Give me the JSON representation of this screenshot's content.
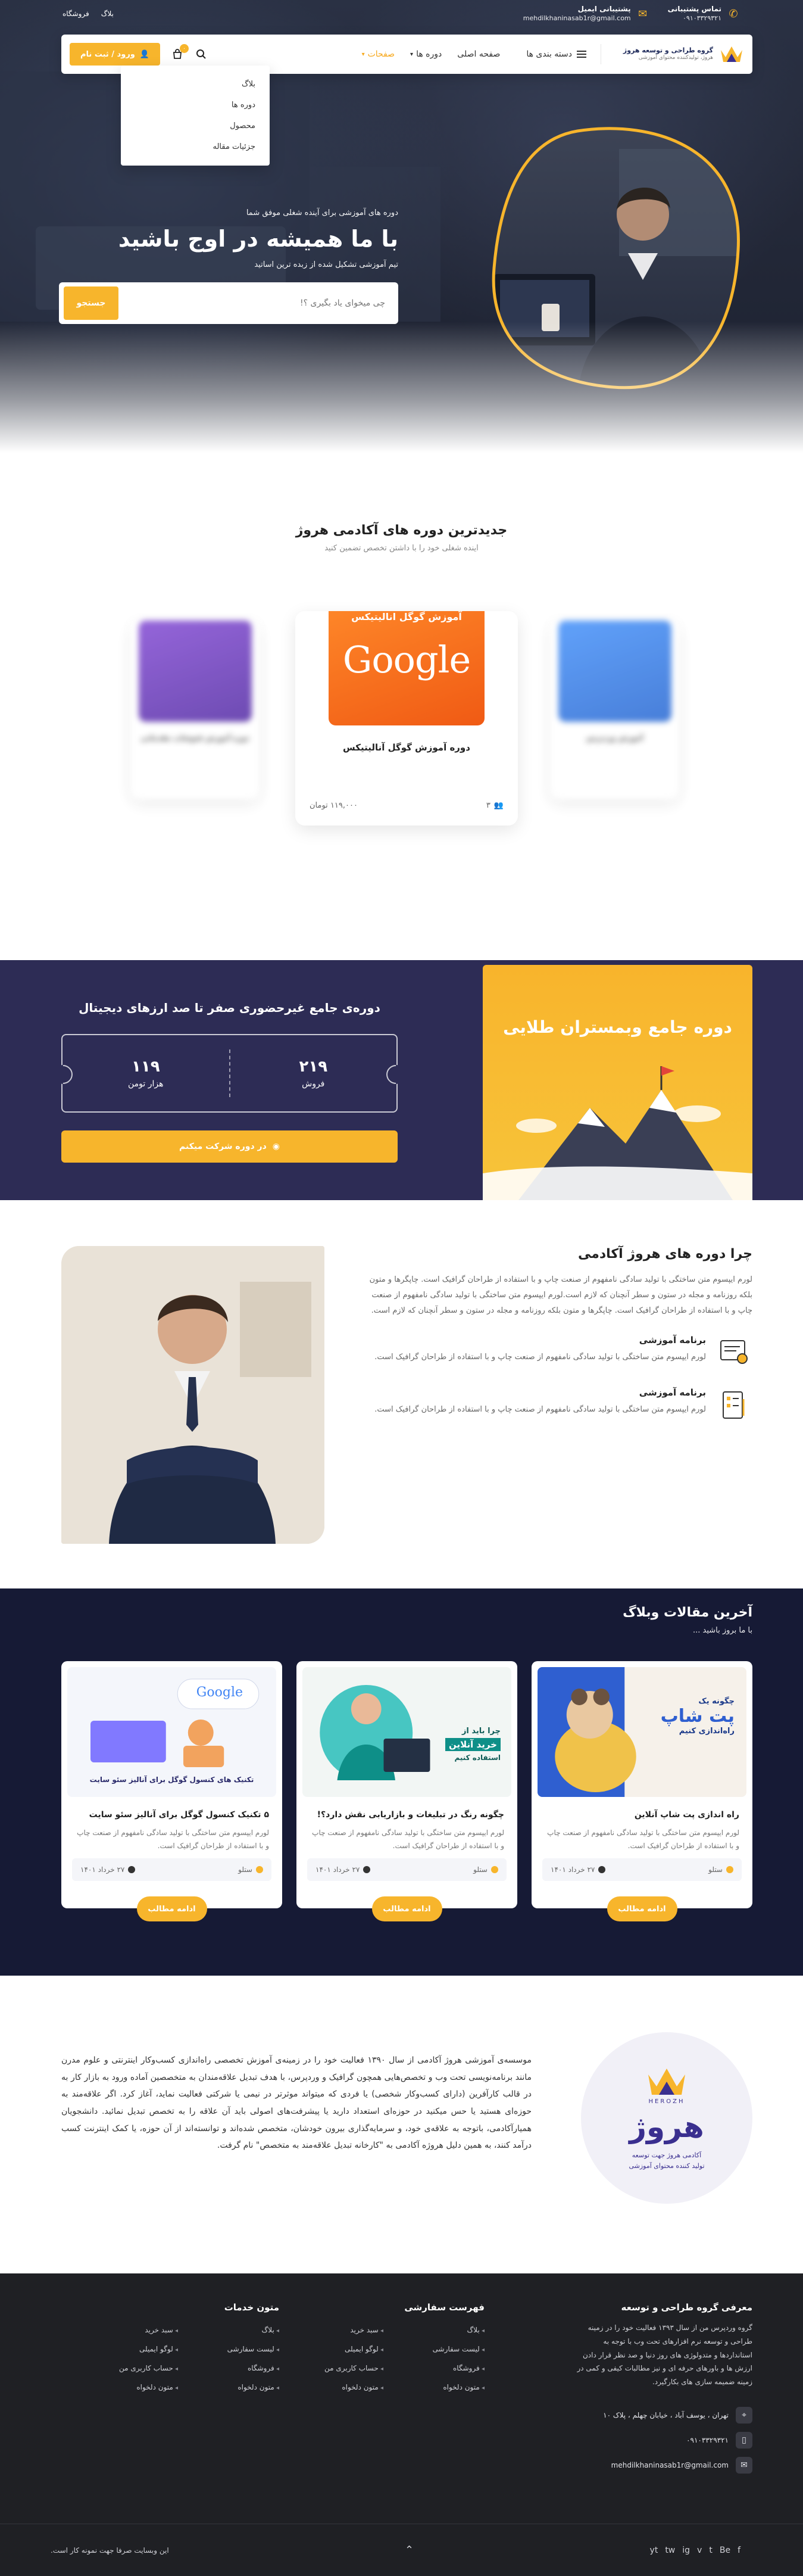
{
  "topbar": {
    "phone_label": "تماس پشتیبانی",
    "phone": "۰۹۱۰۳۳۲۹۳۲۱",
    "email_label": "پشتیبانی ایمیل",
    "email": "mehdilkhaninasab1r@gmail.com",
    "links": [
      "بلاگ",
      "فروشگاه"
    ]
  },
  "header": {
    "logo_title": "گروه طراحی و توسعه هروژ",
    "logo_subtitle": "هروژ، تولیدکننده محتوای آموزشی",
    "categories_label": "دسته بندی ها",
    "menu": [
      {
        "label": "صفحه اصلی",
        "caret": false,
        "active": false
      },
      {
        "label": "دوره ها",
        "caret": true,
        "active": false
      },
      {
        "label": "صفحات",
        "caret": true,
        "active": true
      }
    ],
    "cart_count": "۰",
    "login_label": "ورود / ثبت نام"
  },
  "dropdown": {
    "items": [
      "بلاگ",
      "دوره ها",
      "محصول",
      "جزئیات مقاله"
    ]
  },
  "hero": {
    "kicker": "دوره های آموزشی برای آینده شغلی موفق شما",
    "title": "با ما همیشه در اوج باشید",
    "desc": "تیم آموزشی تشکیل شده از زبده ترین اساتید",
    "search_placeholder": "چی میخوای یاد بگیری ؟!",
    "search_button": "جستجو"
  },
  "courses": {
    "title": "جدیدترین دوره های آکادمی هروژ",
    "subtitle": "اینده شغلی خود را با داشتن تخصص تضمین کنید",
    "center": {
      "thumb_title": "آموزش گوگل انالیتیکس",
      "thumb_word": "Google",
      "title": "دوره آموزش گوگل آنالیتیکس",
      "price": "۱۱۹,۰۰۰ تومان",
      "students": "۳"
    },
    "left_title": "دوره آموزش فتوشاپ مقدماتی",
    "right_title": "آموزش وردپرس"
  },
  "promo": {
    "title": "دوره‌ی جامع غیرحضوری صفر تا صد ارزهای دیجیتال",
    "image_title": "دوره جامع وبمستران طلایی",
    "sales_value": "۲۱۹",
    "sales_label": "فروش",
    "price_value": "۱۱۹",
    "price_label": "هزار تومن",
    "button": "در دوره شرکت میکنم"
  },
  "why": {
    "title": "چرا دوره های هروژ آکادمی",
    "lead": "لورم ایپسوم متن ساختگی با تولید سادگی نامفهوم از صنعت چاپ و با استفاده از طراحان گرافیک است. چاپگرها و متون بلکه روزنامه و مجله در ستون و سطر آنچنان که لازم است.لورم ایپسوم متن ساختگی با تولید سادگی نامفهوم از صنعت چاپ و با استفاده از طراحان گرافیک است. چاپگرها و متون بلکه روزنامه و مجله در ستون و سطر آنچنان که لازم است.",
    "features": [
      {
        "title": "برنامه آموزشی",
        "text": "لورم ایپسوم متن ساختگی با تولید سادگی نامفهوم از صنعت چاپ و با استفاده از طراحان گرافیک است."
      },
      {
        "title": "برنامه آموزشی",
        "text": "لورم ایپسوم متن ساختگی با تولید سادگی نامفهوم از صنعت چاپ و با استفاده از طراحان گرافیک است."
      }
    ]
  },
  "blog": {
    "title": "آخرین مقالات وبلاگ",
    "subtitle": "با ما بروز باشید ...",
    "posts": [
      {
        "img_line1": "چگونه یک",
        "img_line2": "پت شاپ",
        "img_line3": "راه‌اندازی کنیم",
        "title": "راه اندازی پت شاپ آنلاین",
        "excerpt": "لورم ایپسوم متن ساختگی با تولید سادگی نامفهوم از صنعت چاپ و با استفاده از طراحان گرافیک است.",
        "author": "ستلو",
        "date": "۲۷ خرداد ۱۴۰۱",
        "more": "ادامه مطالب"
      },
      {
        "img_line1": "چرا باید از",
        "img_line2": "خرید آنلاین",
        "img_line3": "استفاده کنیم",
        "title": "چگونه رنگ در تبلیغات و بازاریابی نقش دارد؟!",
        "excerpt": "لورم ایپسوم متن ساختگی با تولید سادگی نامفهوم از صنعت چاپ و با استفاده از طراحان گرافیک است.",
        "author": "ستلو",
        "date": "۲۷ خرداد ۱۴۰۱",
        "more": "ادامه مطالب"
      },
      {
        "img_line1": "Google",
        "img_line2": "تکنیک های کنسول گوگل برای آنالیز سئو سایت",
        "img_line3": "",
        "title": "۵ تکنیک کنسول گوگل برای آنالیز سئو سایت",
        "excerpt": "لورم ایپسوم متن ساختگی با تولید سادگی نامفهوم از صنعت چاپ و با استفاده از طراحان گرافیک است.",
        "author": "ستلو",
        "date": "۲۷ خرداد ۱۴۰۱",
        "more": "ادامه مطالب"
      }
    ]
  },
  "about": {
    "brand": "هروژ",
    "brand_en": "HEROZH",
    "tagline": "آکادمی هروژ جهت توسعه\nتولید کننده محتوای آموزشی",
    "text": "موسسه‌ی آموزشی هروژ آکادمی از سال ۱۳۹۰ فعالیت خود را در زمینه‌ی آموزش تخصصی راه‌اندازی کسب‌وکار اینترنتی و علوم مدرن مانند برنامه‌نویسی تحت وب و تخصص‌هایی همچون گرافیک و وردپرس، با هدف تبدیل علاقه‌مندان به متخصصین آماده ورود به بازار کار به در قالب کارآفرین (دارای کسب‌وکار شخصی) یا فردی که میتواند موثرتر در نیمی یا شرکتی فعالیت نماید، آغاز کرد. اگر علاقه‌مند به حوزه‌ای هستید یا حس میکنید در حوزه‌ای استعداد دارید یا پیشرفت‌های اصولی باید آن علاقه را به تخصص تبدیل نمائید. دانشجویان همیارآکادمی، باتوجه به علاقه‌ی خود، و سرمایه‌گذاری بیرون خودشان، متخصص شده‌اند و توانسته‌اند از آن حوزه، یا کمک اینترنت کسب درآمد کنند، به همین دلیل هروژه آکادمی به \"کارخانه تبدیل علاقه‌مند به متخصص\" نام گرفت."
  },
  "footer": {
    "about_title": "معرفی گروه طراحی و توسعه",
    "about_text": "گروه وردپرس من از سال ۱۳۹۳ فعالیت خود را در زمینه طراحی و توسعه نرم افزارهای تحت وب با توجه به استانداردها و متدولوژی های روز دنیا و صد نظر قرار دادن ارزش ها و باورهای حرفه ای و نیز مطالبات کیفی و کمی در زمینه ضمیمه سازی های بکارگیرد.",
    "list1_title": "فهرست سفارشی",
    "list1": [
      "بلاگ",
      "سبد خرید",
      "لیست سفارشی",
      "لوگو ایمیلی",
      "فروشگاه",
      "حساب کاربری من",
      "متون دلخواه",
      "متون دلخواه"
    ],
    "list2_title": "متون خدمات",
    "list2": [
      "بلاگ",
      "سبد خرید",
      "لیست سفارشی",
      "لوگو ایمیلی",
      "فروشگاه",
      "حساب کاربری من",
      "متون دلخواه",
      "متون دلخواه"
    ],
    "address": "تهران ، یوسف آباد ، خیابان چهلم ، پلاک ۱۰",
    "phone": "۰۹۱۰۳۳۲۹۳۲۱",
    "email": "mehdilkhaninasab1r@gmail.com",
    "copyright": "این وبسایت صرفا جهت نمونه کار است.",
    "socials": [
      "f",
      "Be",
      "t",
      "v",
      "ig",
      "tw",
      "yt"
    ]
  },
  "colors": {
    "accent": "#f7b52c",
    "navy": "#2d2c55",
    "blog_bg": "#161a35",
    "footer_bg": "#1f2024"
  }
}
